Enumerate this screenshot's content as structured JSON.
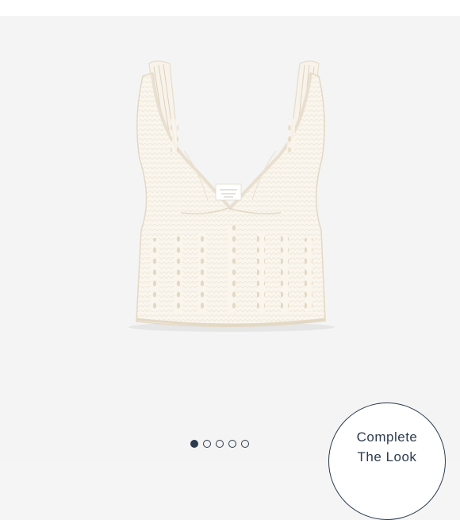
{
  "complete_look": {
    "line1": "Complete",
    "line2": "The Look"
  },
  "carousel": {
    "count": 5,
    "active_index": 0
  },
  "product": {
    "image_icon": "tank-top-image"
  },
  "colors": {
    "accent": "#2c3b4d",
    "background": "#f4f4f4",
    "garment": "#faf6ee"
  }
}
